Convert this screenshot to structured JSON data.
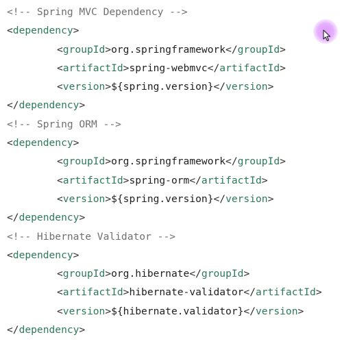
{
  "tags": {
    "open_bracket": "<",
    "close_bracket": ">",
    "end_open": "</",
    "dependency": "dependency",
    "groupId": "groupId",
    "artifactId": "artifactId",
    "version": "version"
  },
  "blocks": [
    {
      "comment": "<!-- Spring MVC Dependency -->",
      "groupId": "org.springframework",
      "artifactId": "spring-webmvc",
      "version": "${spring.version}"
    },
    {
      "comment": "<!-- Spring ORM -->",
      "groupId": "org.springframework",
      "artifactId": "spring-orm",
      "version": "${spring.version}"
    },
    {
      "comment": "<!-- Hibernate Validator -->",
      "groupId": "org.hibernate",
      "artifactId": "hibernate-validator",
      "version": "${hibernate.validator}"
    }
  ],
  "cursor": {
    "icon": "mouse-pointer-icon",
    "highlight_color": "#de96ff"
  }
}
